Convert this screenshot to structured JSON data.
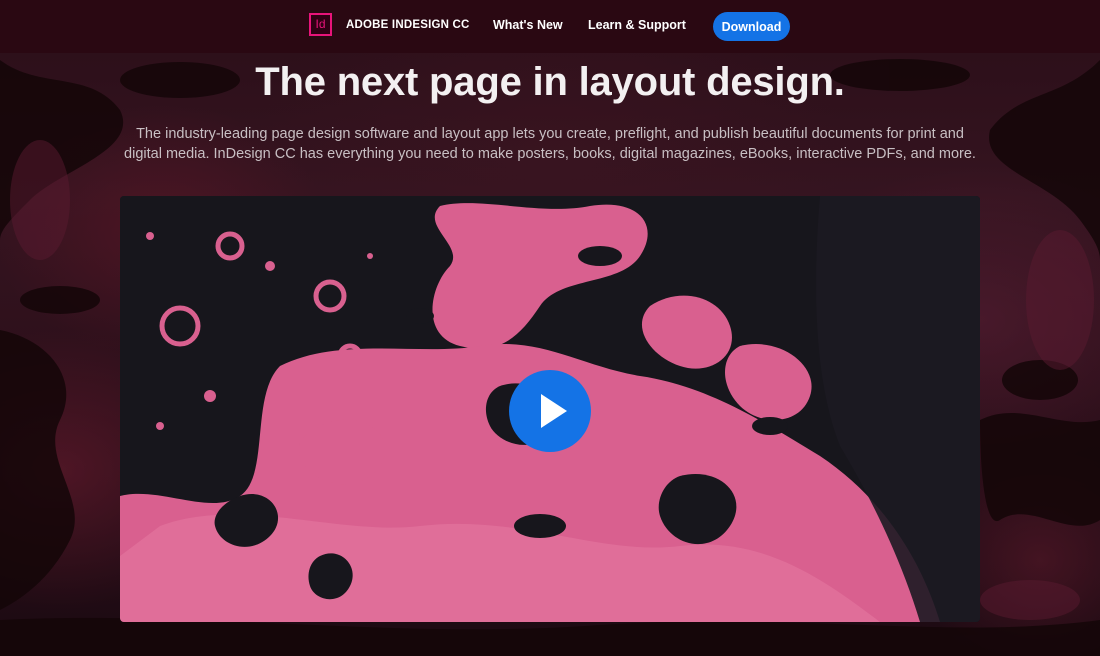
{
  "nav": {
    "logo_text": "Id",
    "brand": "ADOBE INDESIGN CC",
    "links": [
      "What's New",
      "Learn & Support"
    ],
    "cta": "Download"
  },
  "hero": {
    "title": "The next page in layout design.",
    "description": "The industry-leading page design software and layout app lets you create, preflight, and publish beautiful documents for print and digital media. InDesign CC has everything you need to make posters, books, digital magazines, eBooks, interactive PDFs, and more."
  },
  "video": {
    "play_icon": "play-icon"
  },
  "colors": {
    "accent": "#1473e6",
    "brand_pink": "#e8147a",
    "nav_bg": "#2a0812",
    "video_pink": "#d9608f"
  }
}
